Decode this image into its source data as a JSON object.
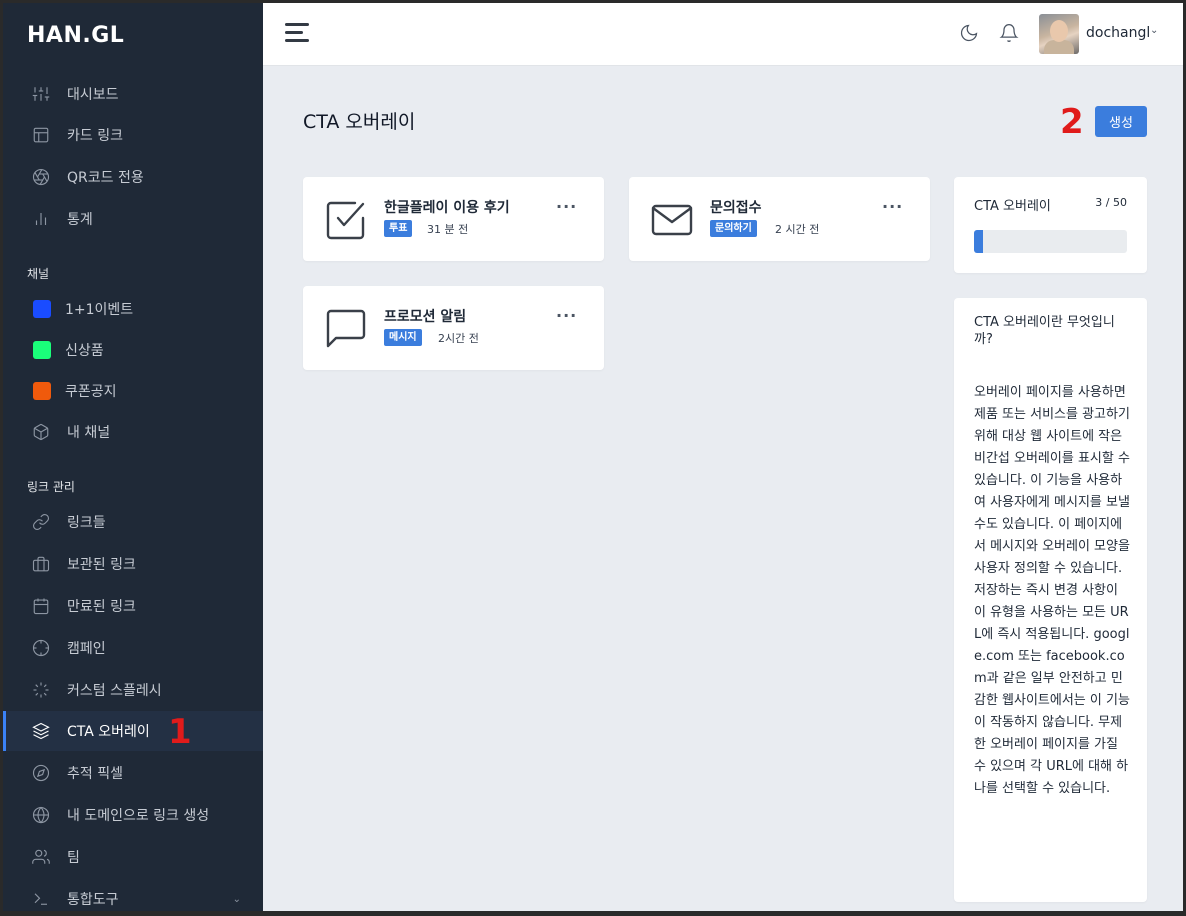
{
  "app": {
    "logo": "HAN.GL"
  },
  "sidebar": {
    "main_items": [
      {
        "label": "대시보드",
        "icon": "sliders-icon"
      },
      {
        "label": "카드 링크",
        "icon": "layout-icon"
      },
      {
        "label": "QR코드 전용",
        "icon": "aperture-icon"
      },
      {
        "label": "통계",
        "icon": "bar-chart-icon"
      }
    ],
    "channels_label": "채널",
    "channels": [
      {
        "label": "1+1이벤트",
        "color": "#1a4cff"
      },
      {
        "label": "신상품",
        "color": "#1aff7a"
      },
      {
        "label": "쿠폰공지",
        "color": "#f05a0c"
      },
      {
        "label": "내 채널",
        "icon": "box-icon"
      }
    ],
    "links_label": "링크 관리",
    "link_items": [
      {
        "label": "링크들",
        "icon": "link-icon"
      },
      {
        "label": "보관된 링크",
        "icon": "briefcase-icon"
      },
      {
        "label": "만료된 링크",
        "icon": "calendar-icon"
      },
      {
        "label": "캠페인",
        "icon": "crosshair-icon"
      },
      {
        "label": "커스텀 스플레시",
        "icon": "loader-icon"
      },
      {
        "label": "CTA 오버레이",
        "icon": "layers-icon",
        "active": true
      },
      {
        "label": "추적 픽셀",
        "icon": "compass-icon"
      },
      {
        "label": "내 도메인으로 링크 생성",
        "icon": "globe-icon"
      },
      {
        "label": "팀",
        "icon": "users-icon"
      },
      {
        "label": "통합도구",
        "icon": "terminal-icon"
      }
    ]
  },
  "annotations": {
    "first": "1",
    "second": "2"
  },
  "header": {
    "username": "dochangl"
  },
  "main": {
    "title": "CTA 오버레이",
    "create_label": "생성",
    "cards": [
      {
        "title": "한글플레이 이용 후기",
        "badge": "투표",
        "time": "31 분 전",
        "icon": "check-square-icon"
      },
      {
        "title": "문의접수",
        "badge": "문의하기",
        "time": "2 시간 전",
        "icon": "mail-icon"
      },
      {
        "title": "프로모션 알림",
        "badge": "메시지",
        "time": "2시간 전",
        "icon": "message-square-icon"
      }
    ],
    "more_label": "···"
  },
  "stats": {
    "title": "CTA 오버레이",
    "count": "3 / 50",
    "progress_fraction": 0.06
  },
  "info": {
    "title": "CTA 오버레이란 무엇입니까?",
    "body": "오버레이 페이지를 사용하면 제품 또는 서비스를 광고하기 위해 대상 웹 사이트에 작은 비간섭 오버레이를 표시할 수 있습니다. 이 기능을 사용하여 사용자에게 메시지를 보낼 수도 있습니다. 이 페이지에서 메시지와 오버레이 모양을 사용자 정의할 수 있습니다. 저장하는 즉시 변경 사항이 이 유형을 사용하는 모든 URL에 즉시 적용됩니다. google.com 또는 facebook.com과 같은 일부 안전하고 민감한 웹사이트에서는 이 기능이 작동하지 않습니다. 무제한 오버레이 페이지를 가질 수 있으며 각 URL에 대해 하나를 선택할 수 있습니다."
  }
}
